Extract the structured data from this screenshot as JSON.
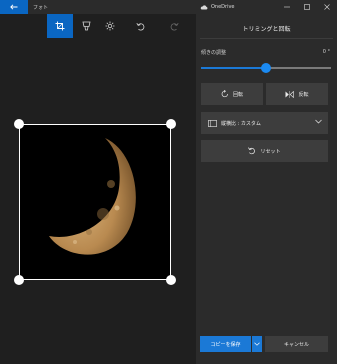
{
  "titlebar": {
    "app_title": "フォト",
    "onedrive_label": "OneDrive"
  },
  "toolbar": {
    "tools": [
      {
        "name": "crop",
        "icon": "crop-icon",
        "active": true
      },
      {
        "name": "filters",
        "icon": "filter-icon",
        "active": false
      },
      {
        "name": "adjust",
        "icon": "brightness-icon",
        "active": false
      },
      {
        "name": "undo",
        "icon": "undo-icon",
        "active": false
      },
      {
        "name": "redo",
        "icon": "redo-icon",
        "active": false
      }
    ]
  },
  "panel": {
    "title": "トリミングと回転",
    "tilt_label": "傾きの調整",
    "tilt_value": "0 °",
    "tilt_slider_fraction": 0.5,
    "rotate_label": "回転",
    "flip_label": "反転",
    "aspect_label": "縦横比 : カスタム",
    "reset_label": "リセット",
    "save_copy_label": "コピーを保存",
    "cancel_label": "キャンセル"
  },
  "colors": {
    "accent": "#1b79d6",
    "titlebar_back": "#0a66c2",
    "panel_bg": "#2b2b2b",
    "canvas_bg": "#1f1f1f"
  }
}
